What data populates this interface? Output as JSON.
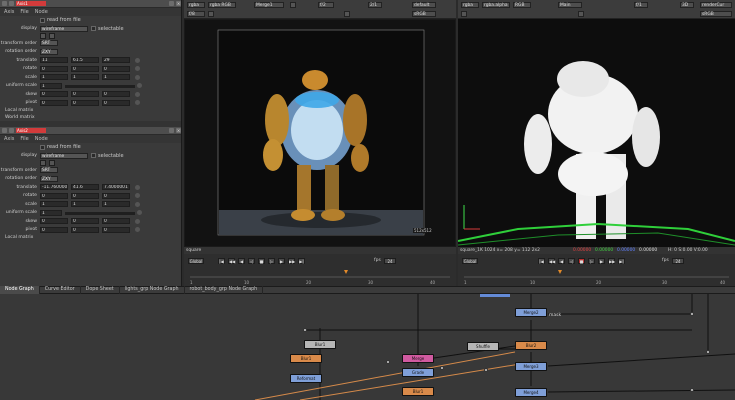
{
  "props": {
    "panels": [
      {
        "node_name": "Axis1",
        "tabs": [
          "Axis",
          "File",
          "Node"
        ],
        "read_from_file": "read from file",
        "display_label": "display",
        "display_value": "wireframe",
        "selectable": "selectable",
        "transform_order_label": "transform order",
        "transform_order": "SRT",
        "rotation_order_label": "rotation order",
        "rotation_order": "ZXY",
        "translate_label": "translate",
        "translate": [
          "11",
          "61.5",
          "29"
        ],
        "rotate_label": "rotate",
        "rotate": [
          "0",
          "0",
          "0"
        ],
        "scale_label": "scale",
        "scale": [
          "1",
          "1",
          "1"
        ],
        "uniform_scale_label": "uniform scale",
        "uniform_scale": "1",
        "skew_label": "skew",
        "skew": [
          "0",
          "0",
          "0"
        ],
        "pivot_label": "pivot",
        "pivot": [
          "0",
          "0",
          "0"
        ],
        "local_matrix": "Local matrix",
        "world_matrix": "World matrix"
      },
      {
        "node_name": "Axis2",
        "tabs": [
          "Axis",
          "File",
          "Node"
        ],
        "read_from_file": "read from file",
        "display_label": "display",
        "display_value": "wireframe",
        "selectable": "selectable",
        "transform_order_label": "transform order",
        "transform_order": "SRT",
        "rotation_order_label": "rotation order",
        "rotation_order": "ZXY",
        "translate_label": "translate",
        "translate": [
          "-11.760000",
          "41.6",
          "7.4000001"
        ],
        "rotate_label": "rotate",
        "rotate": [
          "0",
          "0",
          "0"
        ],
        "scale_label": "scale",
        "scale": [
          "1",
          "1",
          "1"
        ],
        "uniform_scale_label": "uniform scale",
        "uniform_scale": "1",
        "skew_label": "skew",
        "skew": [
          "0",
          "0",
          "0"
        ],
        "pivot_label": "pivot",
        "pivot": [
          "0",
          "0",
          "0"
        ],
        "local_matrix": "Local matrix"
      }
    ]
  },
  "viewer_left": {
    "channels": "rgba",
    "layer": "rgba RGB",
    "input": "Merge1",
    "gain_label": "f/2",
    "zoom": "2/1",
    "frame_label": "f/8",
    "lut": "default",
    "colorspace": "sRGB",
    "status_text": "square",
    "resolution_badge": "512x512",
    "timeline_mode": "Global",
    "fps_label": "fps",
    "fps_value": "24",
    "tick_labels": [
      "1",
      "10",
      "20",
      "30",
      "40"
    ]
  },
  "viewer_right": {
    "channels": "rgba",
    "layer": "rgba.alpha",
    "rgb": "RGB",
    "input": "Main",
    "gain_label": "f/1",
    "view_mode": "3D",
    "renderer": "renderCur",
    "colorspace": "sRGB",
    "status_text": "square_1K 1024  x= 208 y= 112  2x2",
    "pixel_values": [
      "0.00000",
      "0.00000",
      "0.00000",
      "0.00000"
    ],
    "hsv_readout": "H: 0 S:0.00 V:0.00",
    "timeline_mode": "Global",
    "fps_label": "fps",
    "fps_value": "24",
    "tick_labels": [
      "1",
      "10",
      "20",
      "30",
      "40"
    ]
  },
  "node_graph": {
    "tabs": [
      "Node Graph",
      "Curve Editor",
      "Dope Sheet",
      "lights_grp Node Graph",
      "robot_body_grp Node Graph"
    ],
    "nodes": [
      {
        "label": "Blur1",
        "color": "#b6b6b6"
      },
      {
        "label": "Blur1",
        "color": "#d98a4a"
      },
      {
        "label": "Reformat",
        "color": "#7f9fd8"
      },
      {
        "label": "Merge",
        "color": "#d05aa0"
      },
      {
        "label": "Grade",
        "color": "#7f9fd8"
      },
      {
        "label": "Blur1",
        "color": "#d98a4a"
      },
      {
        "label": "Shuffle",
        "color": "#b6b6b6"
      },
      {
        "label": "Merge2",
        "color": "#7f9fd8"
      },
      {
        "label": "Blur2",
        "color": "#d98a4a"
      },
      {
        "label": "Merge3",
        "color": "#7f9fd8"
      },
      {
        "label": "Merge4",
        "color": "#7f9fd8"
      }
    ],
    "mask_label": "mask"
  }
}
